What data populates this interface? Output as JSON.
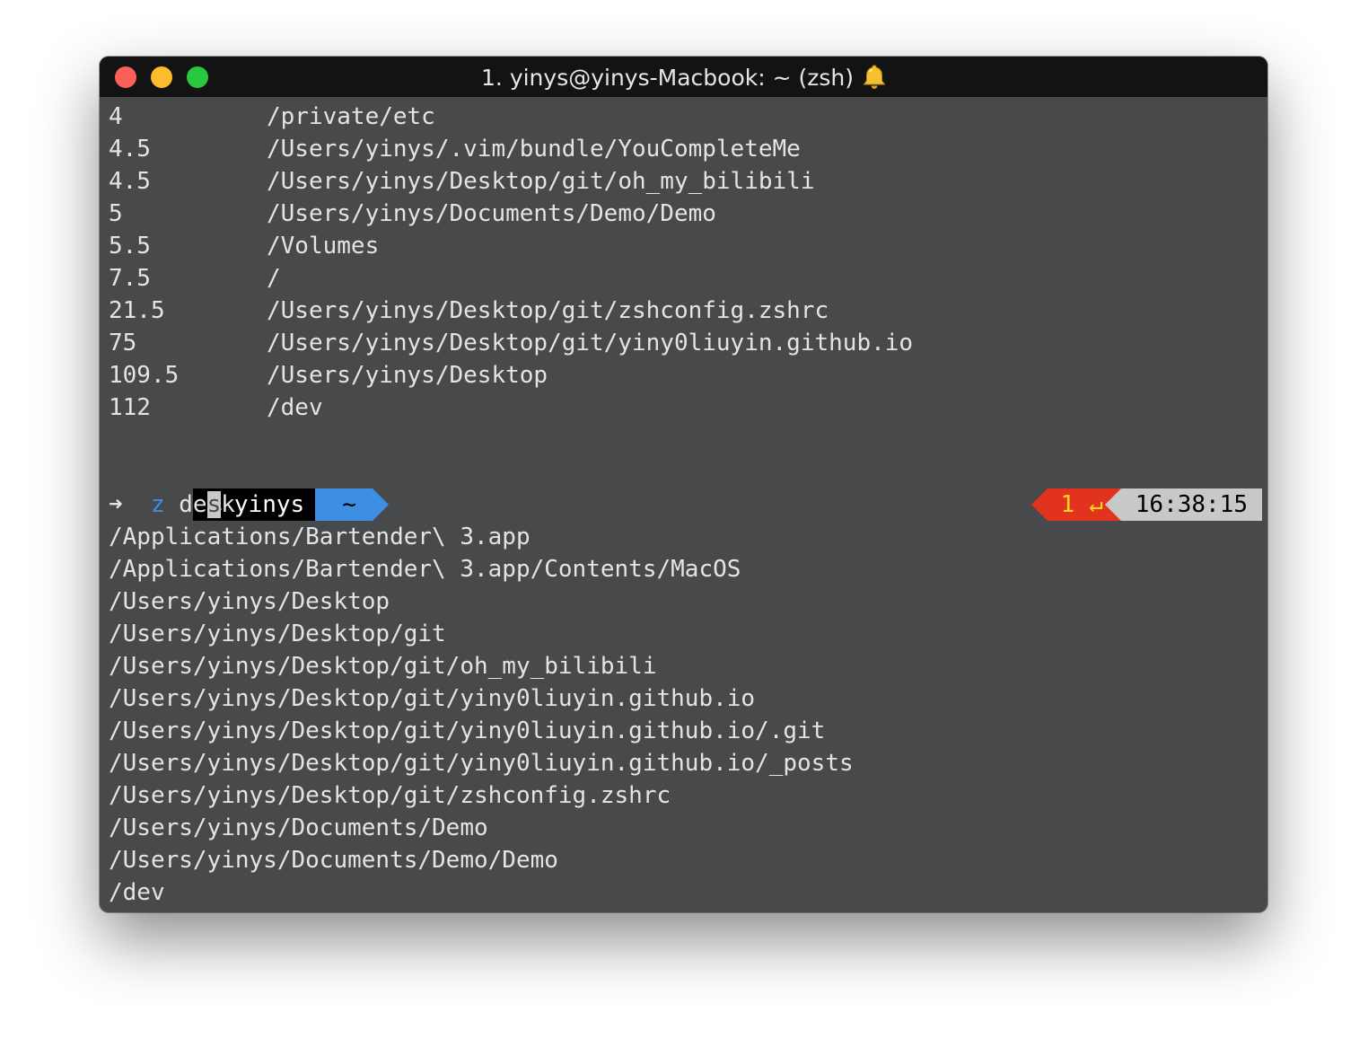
{
  "window": {
    "title": "1. yinys@yinys-Macbook: ~ (zsh)"
  },
  "du_output": [
    {
      "size": "4",
      "path": "/private/etc"
    },
    {
      "size": "4.5",
      "path": "/Users/yinys/.vim/bundle/YouCompleteMe"
    },
    {
      "size": "4.5",
      "path": "/Users/yinys/Desktop/git/oh_my_bilibili"
    },
    {
      "size": "5",
      "path": "/Users/yinys/Documents/Demo/Demo"
    },
    {
      "size": "5.5",
      "path": "/Volumes"
    },
    {
      "size": "7.5",
      "path": "/"
    },
    {
      "size": "21.5",
      "path": "/Users/yinys/Desktop/git/zshconfig.zshrc"
    },
    {
      "size": "75",
      "path": "/Users/yinys/Desktop/git/yiny0liuyin.github.io"
    },
    {
      "size": "109.5",
      "path": "/Users/yinys/Desktop"
    },
    {
      "size": "112",
      "path": "/dev"
    }
  ],
  "prompt": {
    "user": "yinys",
    "dir": "~",
    "arrow": "➜",
    "command": "z",
    "arg_before_cursor": "de",
    "arg_cursor": "s",
    "arg_after_cursor": "k",
    "exit_code": "1",
    "return_symbol": "↵",
    "time": "16:38:15"
  },
  "completions": [
    "/Applications/Bartender\\ 3.app",
    "/Applications/Bartender\\ 3.app/Contents/MacOS",
    "/Users/yinys/Desktop",
    "/Users/yinys/Desktop/git",
    "/Users/yinys/Desktop/git/oh_my_bilibili",
    "/Users/yinys/Desktop/git/yiny0liuyin.github.io",
    "/Users/yinys/Desktop/git/yiny0liuyin.github.io/.git",
    "/Users/yinys/Desktop/git/yiny0liuyin.github.io/_posts",
    "/Users/yinys/Desktop/git/zshconfig.zshrc",
    "/Users/yinys/Documents/Demo",
    "/Users/yinys/Documents/Demo/Demo",
    "/dev"
  ],
  "colors": {
    "background": "#48494b",
    "titlebar": "#131313",
    "user_segment": "#000000",
    "dir_segment": "#3d8fe3",
    "error_segment": "#e2331f",
    "error_text": "#ffd81e",
    "time_segment": "#c8c8c8"
  },
  "icons": {
    "bell": "bell-icon",
    "apple": "apple-icon",
    "return": "return-icon"
  }
}
